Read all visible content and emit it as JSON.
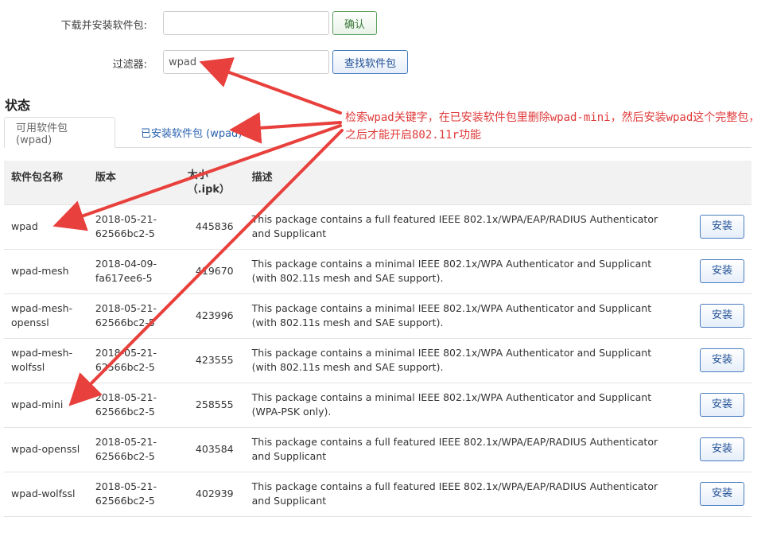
{
  "download": {
    "label": "下载并安装软件包:",
    "value": "",
    "confirm_label": "确认"
  },
  "filter": {
    "label": "过滤器:",
    "value": "wpad",
    "search_label": "查找软件包"
  },
  "status": {
    "title": "状态"
  },
  "tabs": [
    {
      "label": "可用软件包 (wpad)",
      "active": true
    },
    {
      "label": "已安装软件包 (wpad)",
      "active": false
    }
  ],
  "table": {
    "headers": {
      "name": "软件包名称",
      "version": "版本",
      "size": "大小\n（.ipk）",
      "desc": "描述"
    },
    "rows": [
      {
        "name": "wpad",
        "version": "2018-05-21-\n62566bc2-5",
        "size": "445836",
        "desc": "This package contains a full featured IEEE 802.1x/WPA/EAP/RADIUS Authenticator and Supplicant",
        "action": "安装"
      },
      {
        "name": "wpad-mesh",
        "version": "2018-04-09-\nfa617ee6-5",
        "size": "419670",
        "desc": "This package contains a minimal IEEE 802.1x/WPA Authenticator and Supplicant (with 802.11s mesh and SAE support).",
        "action": "安装"
      },
      {
        "name": "wpad-mesh-\nopenssl",
        "version": "2018-05-21-\n62566bc2-5",
        "size": "423996",
        "desc": "This package contains a minimal IEEE 802.1x/WPA Authenticator and Supplicant (with 802.11s mesh and SAE support).",
        "action": "安装"
      },
      {
        "name": "wpad-mesh-\nwolfssl",
        "version": "2018-05-21-\n62566bc2-5",
        "size": "423555",
        "desc": "This package contains a minimal IEEE 802.1x/WPA Authenticator and Supplicant (with 802.11s mesh and SAE support).",
        "action": "安装"
      },
      {
        "name": "wpad-mini",
        "version": "2018-05-21-\n62566bc2-5",
        "size": "258555",
        "desc": "This package contains a minimal IEEE 802.1x/WPA Authenticator and Supplicant (WPA-PSK only).",
        "action": "安装"
      },
      {
        "name": "wpad-openssl",
        "version": "2018-05-21-\n62566bc2-5",
        "size": "403584",
        "desc": "This package contains a full featured IEEE 802.1x/WPA/EAP/RADIUS Authenticator and Supplicant",
        "action": "安装"
      },
      {
        "name": "wpad-wolfssl",
        "version": "2018-05-21-\n62566bc2-5",
        "size": "402939",
        "desc": "This package contains a full featured IEEE 802.1x/WPA/EAP/RADIUS Authenticator and Supplicant",
        "action": "安装"
      }
    ]
  },
  "annotation": {
    "text": "检索wpad关键字，在已安装软件包里删除wpad-mini，然后安装wpad这个完整包，之后才能开启802.11r功能",
    "color": "#e03a3a"
  }
}
